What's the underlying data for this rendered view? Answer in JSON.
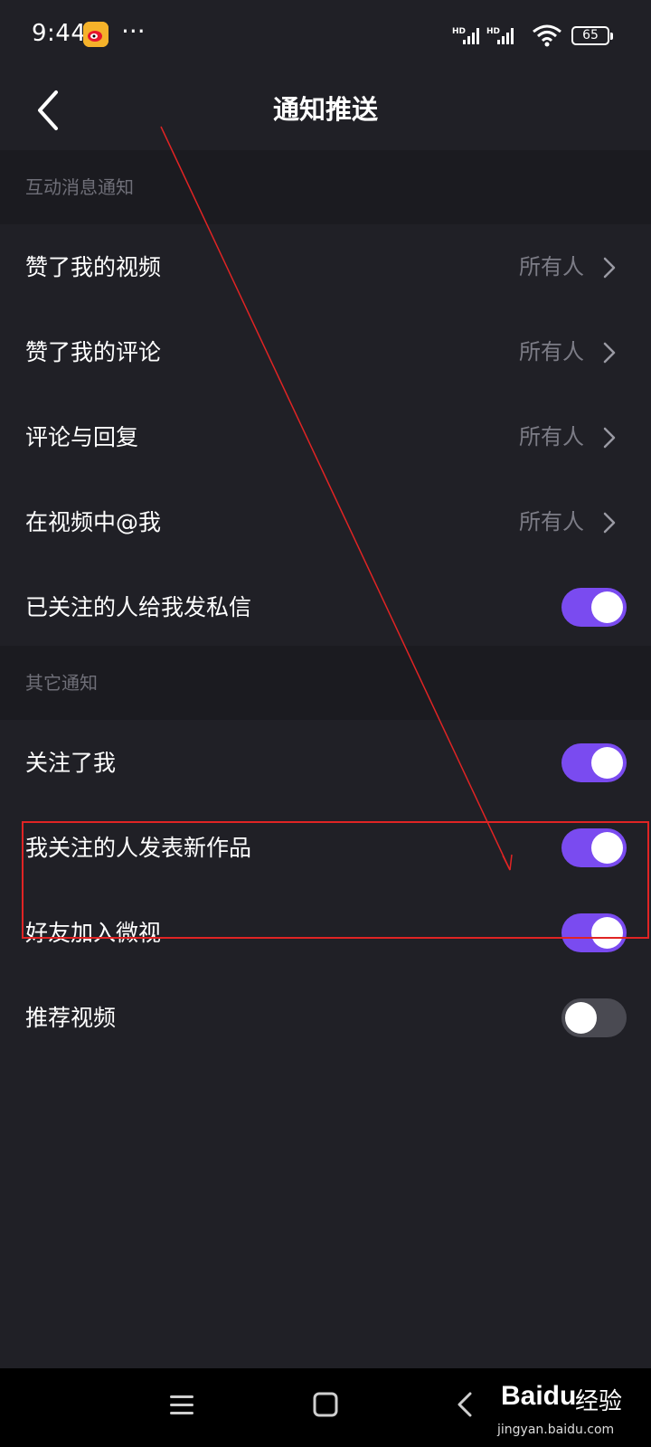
{
  "status_bar": {
    "time": "9:44",
    "more": "···",
    "network_1": "HD",
    "network_2": "HD",
    "battery": "65"
  },
  "header": {
    "title": "通知推送"
  },
  "sections": {
    "interaction": {
      "title": "互动消息通知",
      "rows": [
        {
          "label": "赞了我的视频",
          "value": "所有人"
        },
        {
          "label": "赞了我的评论",
          "value": "所有人"
        },
        {
          "label": "评论与回复",
          "value": "所有人"
        },
        {
          "label": "在视频中@我",
          "value": "所有人"
        },
        {
          "label": "已关注的人给我发私信",
          "toggle": true
        }
      ]
    },
    "other": {
      "title": "其它通知",
      "rows": [
        {
          "label": "关注了我",
          "toggle": true
        },
        {
          "label": "我关注的人发表新作品",
          "toggle": true
        },
        {
          "label": "好友加入微视",
          "toggle": true
        },
        {
          "label": "推荐视频",
          "toggle": false
        }
      ]
    }
  },
  "colors": {
    "toggle_on": "#7a4bf0",
    "toggle_off": "#4a4a52",
    "annotation": "#e02424"
  },
  "watermark": {
    "brand": "Baidu",
    "product": "经验",
    "url": "jingyan.baidu.com"
  }
}
